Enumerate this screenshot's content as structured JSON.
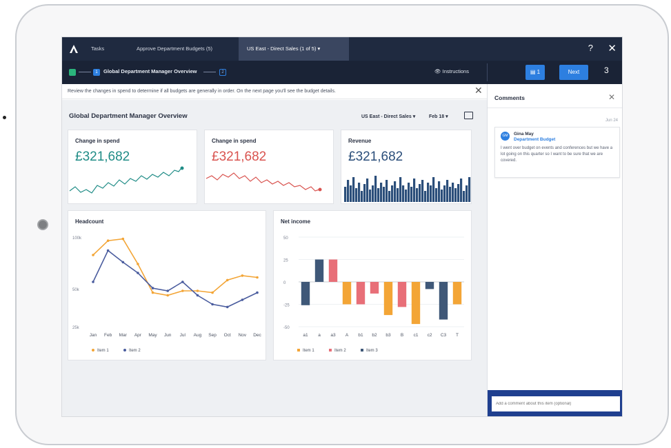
{
  "nav": {
    "tabs": [
      {
        "label": "Tasks"
      },
      {
        "label": "Approve Department Budgets (5)"
      },
      {
        "label": "US East - Direct Sales (1 of 5) ▾"
      }
    ],
    "help": "?",
    "close": "✕"
  },
  "steps": {
    "current_number": "1",
    "current_label": "Global Department Manager Overview",
    "next_number": "2"
  },
  "toolbar": {
    "instructions": "Instructions",
    "comments_count": "1",
    "next_label": "Next",
    "cart_count": "3"
  },
  "notice": {
    "text": "Review the changes in spend to determine if all budgets are generally in order. On the next page you'll see the budget details."
  },
  "dashboard": {
    "title": "Global Department Manager Overview",
    "filter_region": "US East - Direct Sales",
    "filter_period": "Feb 18",
    "cards": [
      {
        "title": "Change in spend",
        "value": "£321,682",
        "color": "#1f8c86"
      },
      {
        "title": "Change in spend",
        "value": "£321,682",
        "color": "#d9534f"
      },
      {
        "title": "Revenue",
        "value": "£321,682",
        "color": "#2b4e7a"
      }
    ]
  },
  "colors": {
    "teal": "#1f8c86",
    "red": "#d9534f",
    "navy": "#2b4e7a",
    "orange": "#f3a536",
    "pink": "#e86f78",
    "slate": "#3f5878",
    "indigo": "#4a5c9e"
  },
  "chart_data": [
    {
      "type": "line",
      "title": "Headcount",
      "x": [
        "Jan",
        "Feb",
        "Mar",
        "Apr",
        "May",
        "Jun",
        "Jul",
        "Aug",
        "Sep",
        "Oct",
        "Nov",
        "Dec"
      ],
      "ytick_labels": [
        "100k",
        "50k",
        "25k"
      ],
      "series": [
        {
          "name": "Item 1",
          "values": [
            80,
            96,
            98,
            70,
            38,
            35,
            40,
            40,
            38,
            52,
            57,
            55
          ]
        },
        {
          "name": "Item 2",
          "values": [
            50,
            85,
            72,
            60,
            43,
            40,
            50,
            35,
            25,
            22,
            30,
            38
          ]
        }
      ],
      "legend": "bottom-left",
      "grid": false
    },
    {
      "type": "bar",
      "title": "Net income",
      "categories": [
        "a1",
        "a",
        "a3",
        "A",
        "b1",
        "b2",
        "b3",
        "B",
        "c1",
        "c2",
        "C3",
        "T"
      ],
      "yticks": [
        50,
        25,
        0,
        -25,
        -50
      ],
      "ylim": [
        -50,
        50
      ],
      "series": [
        {
          "name": "Item 1",
          "values": [
            null,
            null,
            null,
            -25,
            null,
            null,
            -37,
            null,
            -47,
            null,
            null,
            -25
          ]
        },
        {
          "name": "Item 2",
          "values": [
            null,
            null,
            25,
            null,
            -25,
            -13,
            null,
            -28,
            null,
            null,
            null,
            null
          ]
        },
        {
          "name": "Item 3",
          "values": [
            -26,
            25,
            null,
            null,
            null,
            null,
            null,
            null,
            null,
            -8,
            -42,
            null
          ]
        }
      ],
      "legend": "bottom-left",
      "grid": true
    }
  ],
  "sidebar": {
    "title": "Comments",
    "close": "✕",
    "date": "Jun 24",
    "comment": {
      "initials": "GM",
      "author": "Gina May",
      "link": "Department Budget",
      "text": "I went over budget on events and conferences but we have a lot going on this quarter so I want to be sure that we are covered."
    },
    "input_placeholder": "Add a comment about this item (optional)"
  }
}
